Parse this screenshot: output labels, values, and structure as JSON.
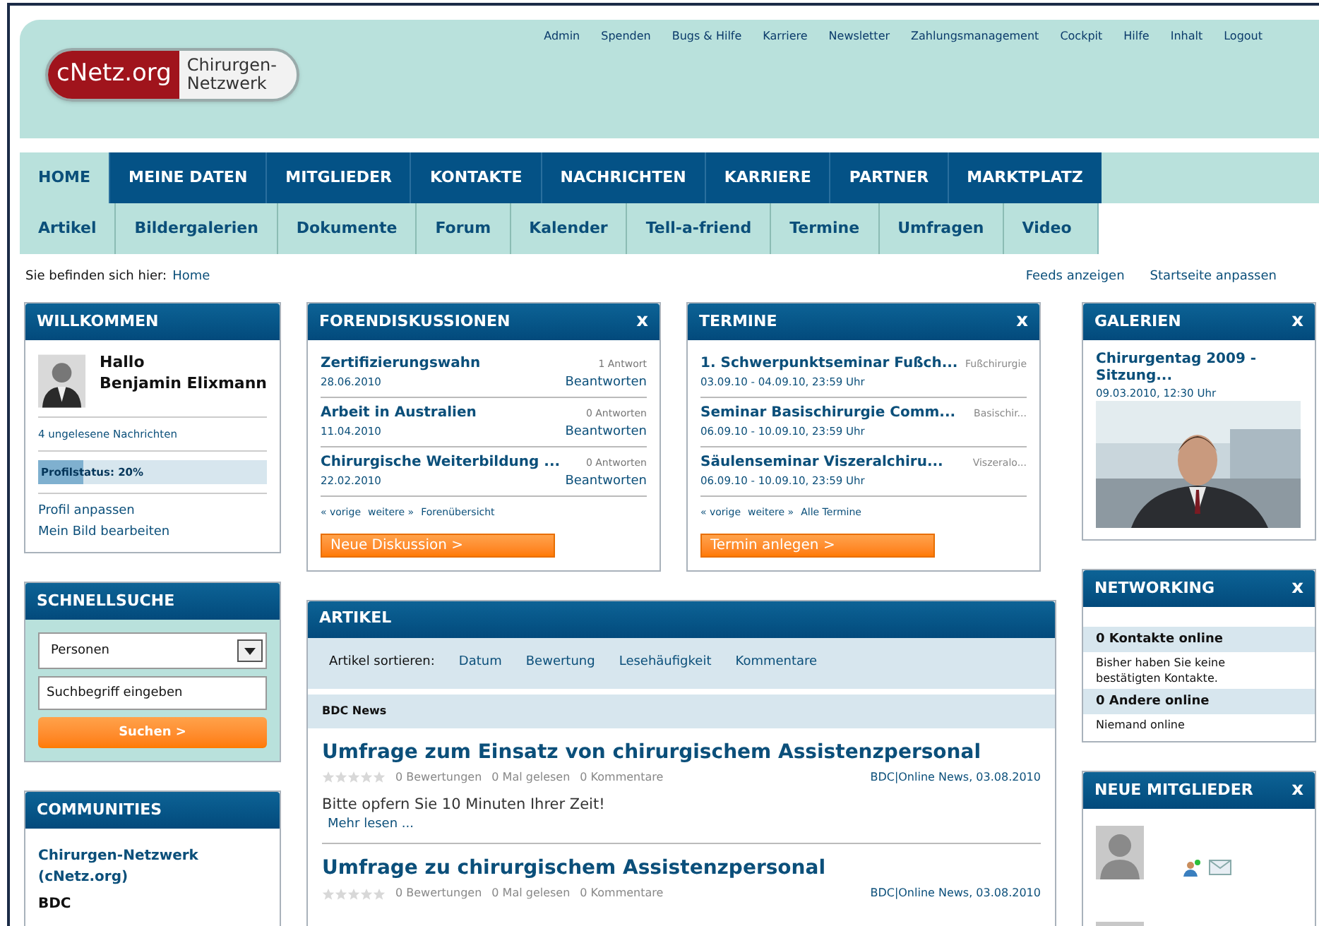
{
  "header": {
    "logo": {
      "left": "cNetz.org",
      "right": "Chirurgen-\nNetzwerk"
    },
    "top_links": [
      "Admin",
      "Spenden",
      "Bugs & Hilfe",
      "Karriere",
      "Newsletter",
      "Zahlungsmanagement",
      "Cockpit",
      "Hilfe",
      "Inhalt",
      "Logout"
    ]
  },
  "main_nav": [
    {
      "label": "HOME",
      "selected": true
    },
    {
      "label": "MEINE DATEN",
      "selected": false
    },
    {
      "label": "MITGLIEDER",
      "selected": false
    },
    {
      "label": "KONTAKTE",
      "selected": false
    },
    {
      "label": "NACHRICHTEN",
      "selected": false
    },
    {
      "label": "KARRIERE",
      "selected": false
    },
    {
      "label": "PARTNER",
      "selected": false
    },
    {
      "label": "MARKTPLATZ",
      "selected": false
    }
  ],
  "sub_nav": [
    "Artikel",
    "Bildergalerien",
    "Dokumente",
    "Forum",
    "Kalender",
    "Tell-a-friend",
    "Termine",
    "Umfragen",
    "Video"
  ],
  "breadcrumb": {
    "label": "Sie befinden sich hier:",
    "link": "Home"
  },
  "page_links": [
    "Feeds anzeigen",
    "Startseite anpassen"
  ],
  "welcome": {
    "title": "WILLKOMMEN",
    "greeting": "Hallo",
    "name": "Benjamin Elixmann",
    "messages": "4 ungelesene Nachrichten",
    "profile_status": {
      "label": "Profilstatus: 20%",
      "level": 0.2
    },
    "links": [
      "Profil anpassen",
      "Mein Bild bearbeiten"
    ]
  },
  "quick_search": {
    "title": "SCHNELLSUCHE",
    "category": "Personen",
    "placeholder": "Suchbegriff eingeben",
    "button": "Suchen >"
  },
  "communities": {
    "title": "COMMUNITIES",
    "items": [
      "Chirurgen-Netzwerk (cNetz.org)",
      "BDC"
    ]
  },
  "forum": {
    "title": "FORENDISKUSSIONEN",
    "close": "x",
    "items": [
      {
        "title": "Zertifizierungswahn",
        "date": "28.06.2010",
        "count": "1 Antwort",
        "action": "Beantworten"
      },
      {
        "title": "Arbeit in Australien",
        "date": "11.04.2010",
        "count": "0 Antworten",
        "action": "Beantworten"
      },
      {
        "title": "Chirurgische Weiterbildung ...",
        "date": "22.02.2010",
        "count": "0 Antworten",
        "action": "Beantworten"
      }
    ],
    "pager": [
      "« vorige",
      "weitere »",
      "Forenübersicht"
    ],
    "button": "Neue Diskussion >"
  },
  "events": {
    "title": "TERMINE",
    "close": "x",
    "items": [
      {
        "title": "1. Schwerpunktseminar Fußch...",
        "date": "03.09.10 - 04.09.10, 23:59 Uhr",
        "category": "Fußchirurgie"
      },
      {
        "title": "Seminar Basischirurgie Comm...",
        "date": "06.09.10 - 10.09.10, 23:59 Uhr",
        "category": "Basischir..."
      },
      {
        "title": "Säulenseminar Viszeralchiru...",
        "date": "06.09.10 - 10.09.10, 23:59 Uhr",
        "category": "Viszeralo..."
      }
    ],
    "pager": [
      "« vorige",
      "weitere »",
      "Alle Termine"
    ],
    "button": "Termin anlegen >"
  },
  "articles": {
    "title": "ARTIKEL",
    "sort_label": "Artikel sortieren:",
    "sort_options": [
      "Datum",
      "Bewertung",
      "Lesehäufigkeit",
      "Kommentare"
    ],
    "section": "BDC News",
    "items": [
      {
        "title": "Umfrage zum Einsatz von chirurgischem Assistenzpersonal",
        "stars": 0,
        "ratings": "0 Bewertungen",
        "reads": "0 Mal gelesen",
        "comments": "0 Kommentare",
        "source": "BDC|Online News, 03.08.2010",
        "teaser": "Bitte opfern Sie 10 Minuten Ihrer Zeit!",
        "more": "Mehr lesen ..."
      },
      {
        "title": "Umfrage zu chirurgischem Assistenzpersonal",
        "stars": 0,
        "ratings": "0 Bewertungen",
        "reads": "0 Mal gelesen",
        "comments": "0 Kommentare",
        "source": "BDC|Online News, 03.08.2010"
      }
    ]
  },
  "galleries": {
    "title": "GALERIEN",
    "close": "x",
    "item": {
      "title": "Chirurgentag 2009 - Sitzung...",
      "date": "09.03.2010, 12:30 Uhr",
      "kind": "picture"
    }
  },
  "networking": {
    "title": "NETWORKING",
    "close": "x",
    "sections": [
      {
        "heading": "0 Kontakte online",
        "text": "Bisher haben Sie keine bestätigten Kontakte."
      },
      {
        "heading": "0 Andere online",
        "text": "Niemand online"
      }
    ]
  },
  "new_members": {
    "title": "NEUE MITGLIEDER",
    "close": "x"
  }
}
